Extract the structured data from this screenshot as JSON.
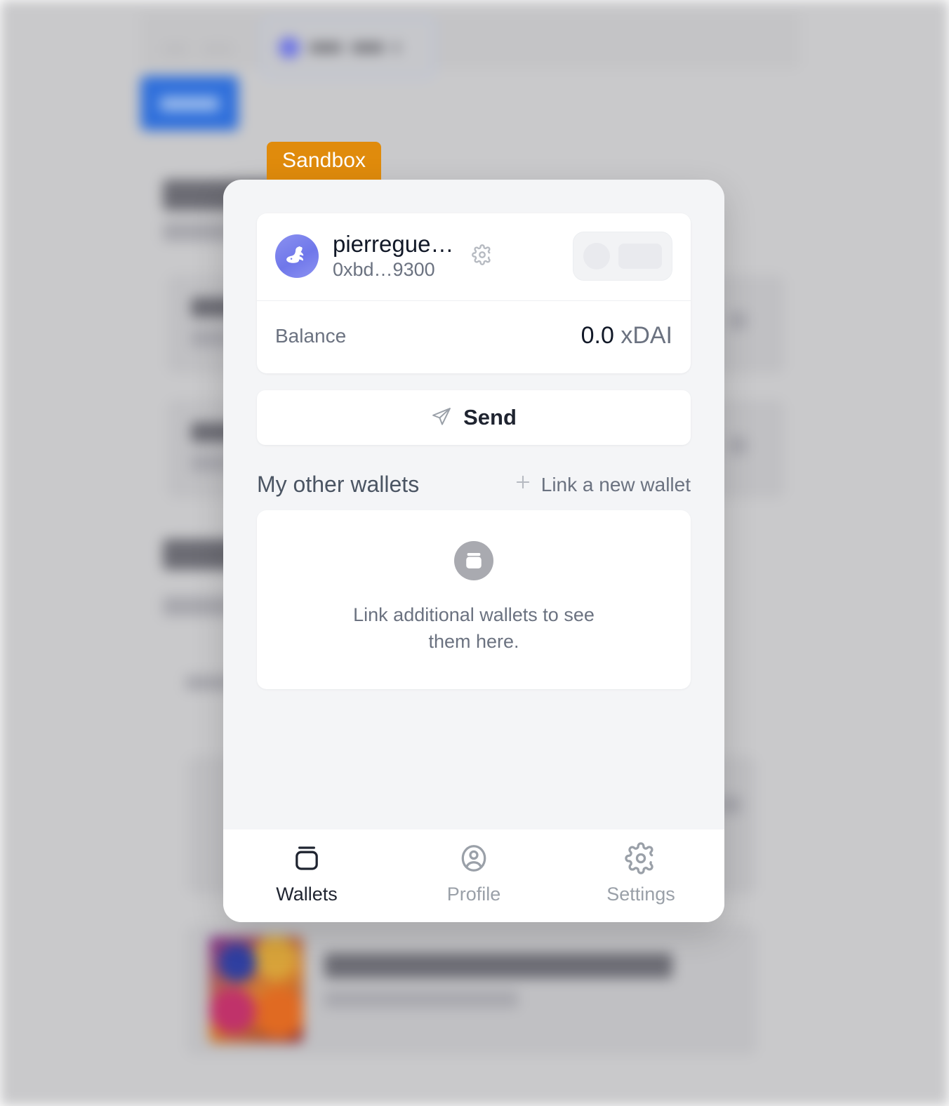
{
  "background": {
    "button_label": "Back",
    "chip_label": "100.000",
    "note": "blurred underlying page"
  },
  "badge": {
    "label": "Sandbox",
    "color": "#E08B0C"
  },
  "modal": {
    "account": {
      "avatar_icon": "rabbit-avatar-icon",
      "name": "pierregue…",
      "address": "0xbd…9300",
      "settings_icon": "gear-icon",
      "network_selector_state": "loading-skeleton"
    },
    "balance": {
      "label": "Balance",
      "amount": "0.0",
      "currency": "xDAI"
    },
    "send": {
      "label": "Send",
      "icon": "send-paper-plane-icon"
    },
    "other_wallets": {
      "title": "My other wallets",
      "link_label": "Link a new wallet",
      "link_icon": "plus-icon",
      "empty_icon": "wallet-icon",
      "empty_text": "Link additional wallets to see them here."
    },
    "nav": {
      "items": [
        {
          "label": "Wallets",
          "icon": "wallet-icon",
          "active": true
        },
        {
          "label": "Profile",
          "icon": "profile-icon",
          "active": false
        },
        {
          "label": "Settings",
          "icon": "gear-icon",
          "active": false
        }
      ]
    }
  }
}
